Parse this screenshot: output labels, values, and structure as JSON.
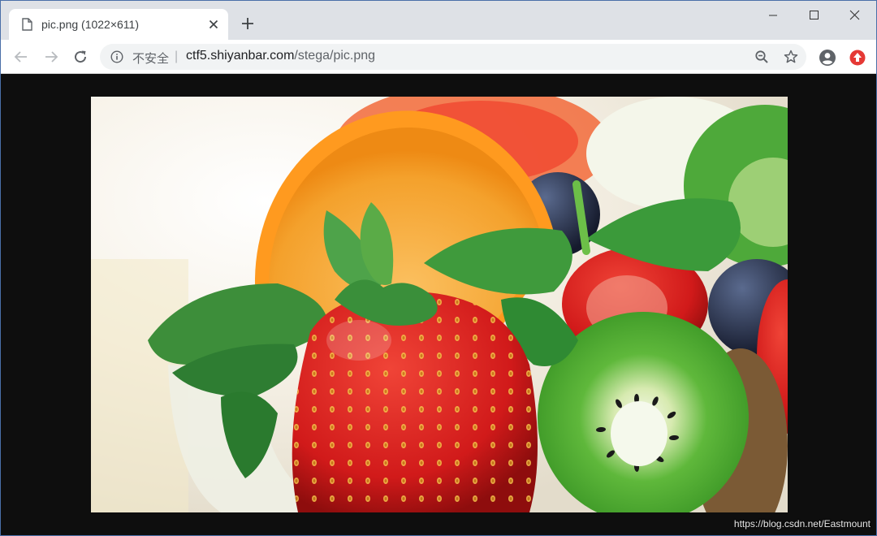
{
  "tab": {
    "title": "pic.png (1022×611)",
    "icon": "file-icon"
  },
  "window_controls": [
    "minimize-icon",
    "maximize-icon",
    "close-icon"
  ],
  "toolbar": {
    "security_label": "不安全",
    "separator": "|",
    "url_host": "ctf5.shiyanbar.com",
    "url_path": "/stega/pic.png"
  },
  "page": {
    "image_subject": "strawberries-kiwi-orange-blueberries",
    "watermark": "https://blog.csdn.net/Eastmount"
  },
  "colors": {
    "tabstrip": "#dee1e6",
    "page_background": "#0e0e0e",
    "profile_icon": "#5f6368",
    "extension_icon": "#e53935"
  }
}
